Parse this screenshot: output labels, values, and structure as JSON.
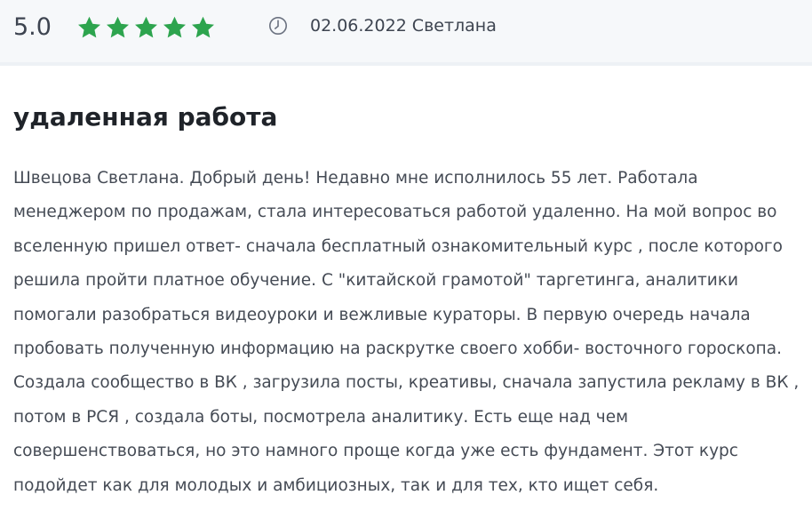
{
  "review": {
    "rating": "5.0",
    "stars_filled": 5,
    "stars_total": 5,
    "star_color": "#2da44e",
    "date": "02.06.2022",
    "author": "Светлана",
    "date_icon": "clock-icon",
    "title": "удаленная работа",
    "text_lines": [
      "Швецова Светлана. Добрый день! Недавно мне исполнилось 55 лет. Работала",
      "менеджером по продажам, стала интересоваться работой удаленно. На мой вопрос во",
      "вселенную пришел ответ- сначала бесплатный ознакомительный курс , после которого",
      "решила пройти платное обучение. С \"китайской грамотой\" таргетинга, аналитики",
      "помогали разобраться видеоуроки и вежливые кураторы. В первую очередь начала",
      "пробовать полученную информацию на раскрутке своего хобби- восточного гороскопа.",
      "Создала сообщество в ВК , загрузила посты, креативы, сначала запустила рекламу в ВК ,",
      "потом в РСЯ , создала боты, посмотрела аналитику. Есть еще над чем",
      "совершенствоваться, но это намного проще когда уже есть фундамент. Этот курс",
      "подойдет как для молодых и амбициозных, так и для тех, кто ищет себя."
    ]
  }
}
